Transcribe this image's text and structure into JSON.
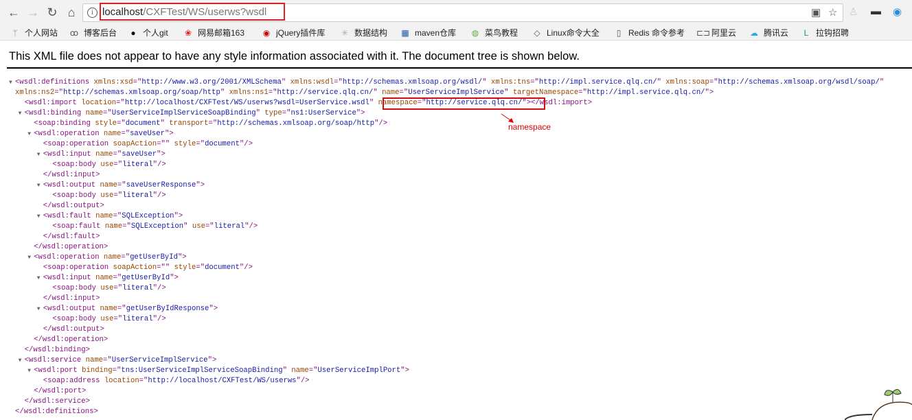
{
  "browser": {
    "url_host": "localhost",
    "url_path": "/CXFTest/WS/userws?wsdl",
    "bookmarks": [
      {
        "icon": "apps-icon",
        "label": "个人网站"
      },
      {
        "icon": "person-icon",
        "label": "博客后台"
      },
      {
        "icon": "github-icon",
        "label": "个人git"
      },
      {
        "icon": "mail-icon",
        "label": "网易邮箱163"
      },
      {
        "icon": "jquery-icon",
        "label": "jQuery插件库"
      },
      {
        "icon": "structure-icon",
        "label": "数据结构"
      },
      {
        "icon": "maven-icon",
        "label": "maven仓库"
      },
      {
        "icon": "runoob-icon",
        "label": "菜鸟教程"
      },
      {
        "icon": "linux-icon",
        "label": "Linux命令大全"
      },
      {
        "icon": "page-icon",
        "label": "Redis 命令参考"
      },
      {
        "icon": "aliyun-icon",
        "label": "阿里云"
      },
      {
        "icon": "tencent-cloud-icon",
        "label": "腾讯云"
      },
      {
        "icon": "lagou-icon",
        "label": "拉钩招聘"
      }
    ]
  },
  "page": {
    "message": "This XML file does not appear to have any style information associated with it. The document tree is shown below.",
    "annotation": "namespace",
    "colors": {
      "tag": "#881280",
      "attr_name": "#994500",
      "attr_value": "#1a1aa6",
      "highlight": "#d01010"
    }
  },
  "xml_lines": [
    {
      "l": 0,
      "tg": true,
      "open": "wsdl:definitions",
      "attrs": [
        [
          "xmlns:xsd",
          "http://www.w3.org/2001/XMLSchema"
        ],
        [
          "xmlns:wsdl",
          "http://schemas.xmlsoap.org/wsdl/"
        ],
        [
          "xmlns:tns",
          "http://impl.service.qlq.cn/"
        ],
        [
          "xmlns:soap",
          "http://schemas.xmlsoap.org/wsdl/soap/"
        ]
      ],
      "tail": ""
    },
    {
      "l": 0,
      "cont": true,
      "attrs": [
        [
          "xmlns:ns2",
          "http://schemas.xmlsoap.org/soap/http"
        ],
        [
          "xmlns:ns1",
          "http://service.qlq.cn/"
        ],
        [
          "name",
          "UserServiceImplService"
        ],
        [
          "targetNamespace",
          "http://impl.service.qlq.cn/"
        ]
      ],
      "tail": ">"
    },
    {
      "l": 1,
      "open": "wsdl:import",
      "attrs": [
        [
          "location",
          "http://localhost/CXFTest/WS/userws?wsdl=UserService.wsdl"
        ],
        [
          "namespace",
          "http://service.qlq.cn/"
        ]
      ],
      "tail": "></wsdl:import>"
    },
    {
      "l": 1,
      "tg": true,
      "open": "wsdl:binding",
      "attrs": [
        [
          "name",
          "UserServiceImplServiceSoapBinding"
        ],
        [
          "type",
          "ns1:UserService"
        ]
      ],
      "tail": ">"
    },
    {
      "l": 2,
      "open": "soap:binding",
      "attrs": [
        [
          "style",
          "document"
        ],
        [
          "transport",
          "http://schemas.xmlsoap.org/soap/http"
        ]
      ],
      "tail": "/>"
    },
    {
      "l": 2,
      "tg": true,
      "open": "wsdl:operation",
      "attrs": [
        [
          "name",
          "saveUser"
        ]
      ],
      "tail": ">"
    },
    {
      "l": 3,
      "open": "soap:operation",
      "attrs": [
        [
          "soapAction",
          ""
        ],
        [
          "style",
          "document"
        ]
      ],
      "tail": "/>"
    },
    {
      "l": 3,
      "tg": true,
      "open": "wsdl:input",
      "attrs": [
        [
          "name",
          "saveUser"
        ]
      ],
      "tail": ">"
    },
    {
      "l": 4,
      "open": "soap:body",
      "attrs": [
        [
          "use",
          "literal"
        ]
      ],
      "tail": "/>"
    },
    {
      "l": 3,
      "close": "wsdl:input"
    },
    {
      "l": 3,
      "tg": true,
      "open": "wsdl:output",
      "attrs": [
        [
          "name",
          "saveUserResponse"
        ]
      ],
      "tail": ">"
    },
    {
      "l": 4,
      "open": "soap:body",
      "attrs": [
        [
          "use",
          "literal"
        ]
      ],
      "tail": "/>"
    },
    {
      "l": 3,
      "close": "wsdl:output"
    },
    {
      "l": 3,
      "tg": true,
      "open": "wsdl:fault",
      "attrs": [
        [
          "name",
          "SQLException"
        ]
      ],
      "tail": ">"
    },
    {
      "l": 4,
      "open": "soap:fault",
      "attrs": [
        [
          "name",
          "SQLException"
        ],
        [
          "use",
          "literal"
        ]
      ],
      "tail": "/>"
    },
    {
      "l": 3,
      "close": "wsdl:fault"
    },
    {
      "l": 2,
      "close": "wsdl:operation"
    },
    {
      "l": 2,
      "tg": true,
      "open": "wsdl:operation",
      "attrs": [
        [
          "name",
          "getUserById"
        ]
      ],
      "tail": ">"
    },
    {
      "l": 3,
      "open": "soap:operation",
      "attrs": [
        [
          "soapAction",
          ""
        ],
        [
          "style",
          "document"
        ]
      ],
      "tail": "/>"
    },
    {
      "l": 3,
      "tg": true,
      "open": "wsdl:input",
      "attrs": [
        [
          "name",
          "getUserById"
        ]
      ],
      "tail": ">"
    },
    {
      "l": 4,
      "open": "soap:body",
      "attrs": [
        [
          "use",
          "literal"
        ]
      ],
      "tail": "/>"
    },
    {
      "l": 3,
      "close": "wsdl:input"
    },
    {
      "l": 3,
      "tg": true,
      "open": "wsdl:output",
      "attrs": [
        [
          "name",
          "getUserByIdResponse"
        ]
      ],
      "tail": ">"
    },
    {
      "l": 4,
      "open": "soap:body",
      "attrs": [
        [
          "use",
          "literal"
        ]
      ],
      "tail": "/>"
    },
    {
      "l": 3,
      "close": "wsdl:output"
    },
    {
      "l": 2,
      "close": "wsdl:operation"
    },
    {
      "l": 1,
      "close": "wsdl:binding"
    },
    {
      "l": 1,
      "tg": true,
      "open": "wsdl:service",
      "attrs": [
        [
          "name",
          "UserServiceImplService"
        ]
      ],
      "tail": ">"
    },
    {
      "l": 2,
      "tg": true,
      "open": "wsdl:port",
      "attrs": [
        [
          "binding",
          "tns:UserServiceImplServiceSoapBinding"
        ],
        [
          "name",
          "UserServiceImplPort"
        ]
      ],
      "tail": ">"
    },
    {
      "l": 3,
      "open": "soap:address",
      "attrs": [
        [
          "location",
          "http://localhost/CXFTest/WS/userws"
        ]
      ],
      "tail": "/>"
    },
    {
      "l": 2,
      "close": "wsdl:port"
    },
    {
      "l": 1,
      "close": "wsdl:service"
    },
    {
      "l": 0,
      "close": "wsdl:definitions"
    }
  ]
}
